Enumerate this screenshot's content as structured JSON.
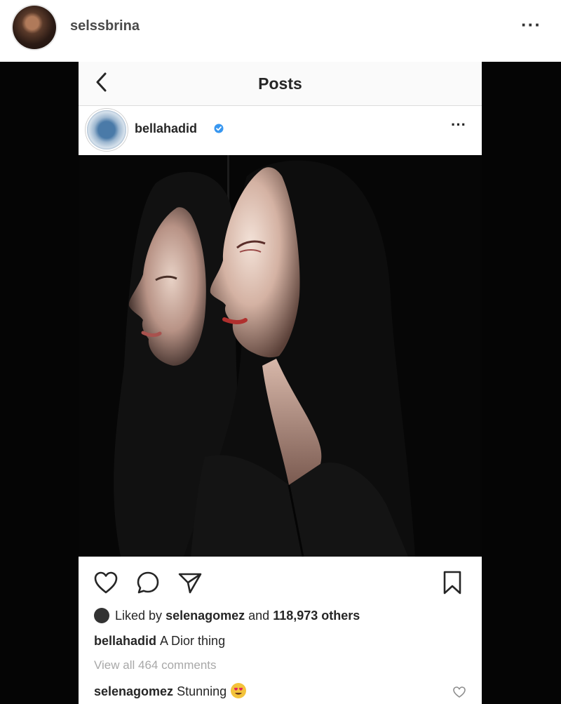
{
  "outer": {
    "username": "selssbrina",
    "more_label": "···"
  },
  "nav": {
    "title": "Posts"
  },
  "post": {
    "username": "bellahadid",
    "more_label": "···",
    "likes": {
      "prefix": "Liked by",
      "user": "selenagomez",
      "middle": "and",
      "count": "118,973 others"
    },
    "caption": {
      "user": "bellahadid",
      "text": "A Dior thing"
    },
    "view_comments": "View all 464 comments",
    "comment": {
      "user": "selenagomez",
      "text": "Stunning"
    }
  },
  "icons": [
    "back-chevron-icon",
    "verified-badge-icon",
    "heart-icon",
    "comment-icon",
    "share-icon",
    "bookmark-icon"
  ],
  "colors": {
    "verified": "#3897f0",
    "text": "#262626",
    "muted": "#a8a8a8",
    "backdrop": "#050505"
  }
}
